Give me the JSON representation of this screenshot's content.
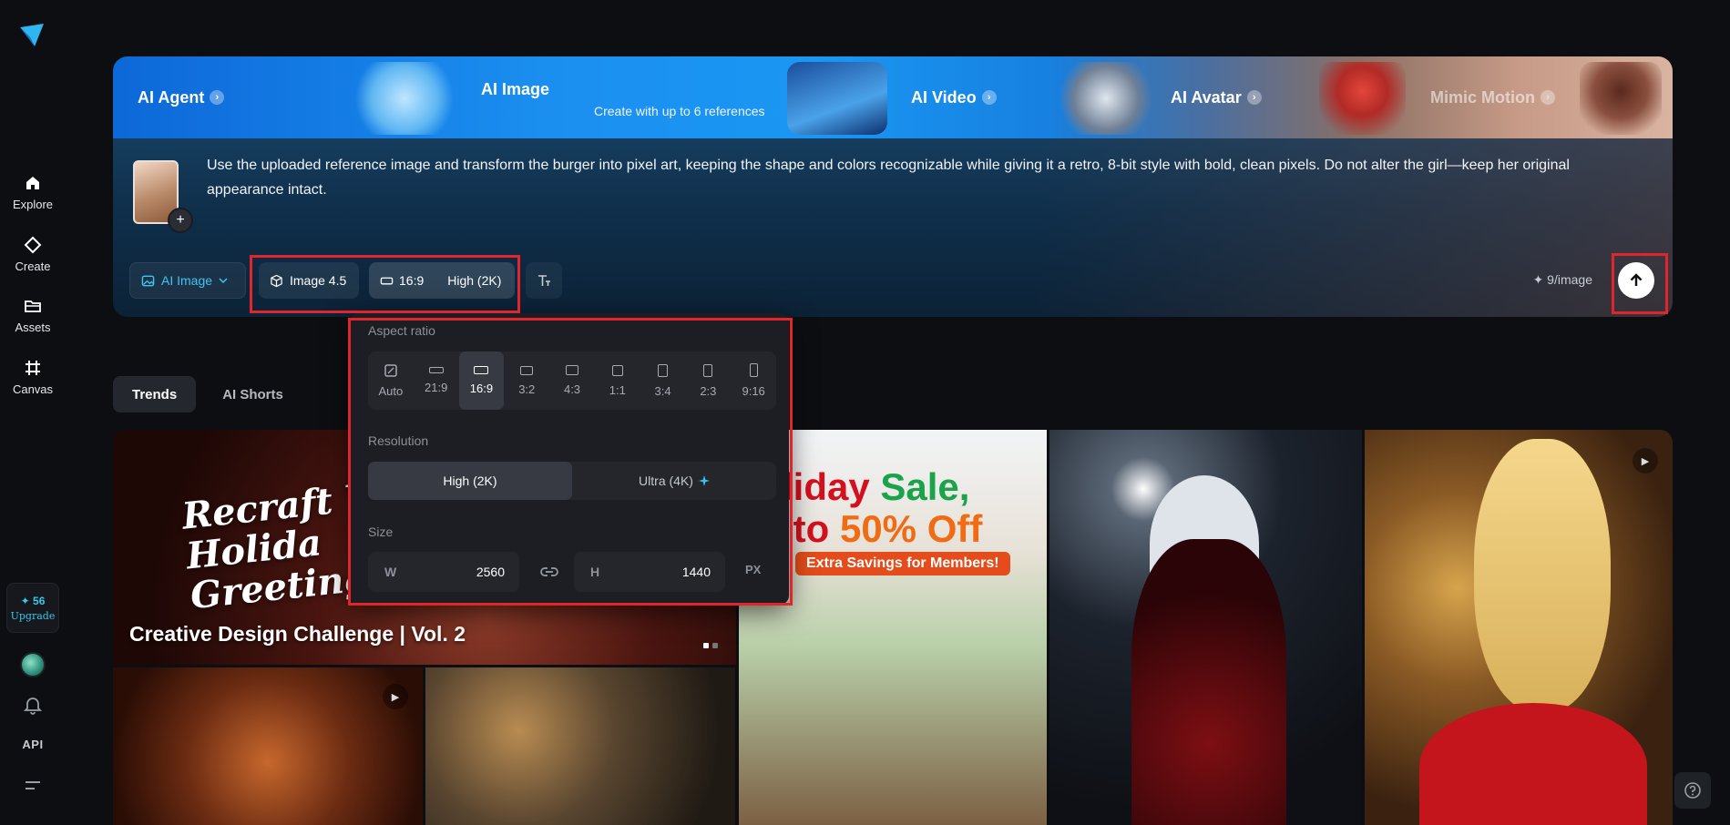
{
  "sidebar": {
    "items": [
      {
        "label": "Explore"
      },
      {
        "label": "Create"
      },
      {
        "label": "Assets"
      },
      {
        "label": "Canvas"
      }
    ],
    "upgrade": {
      "credits": "✦ 56",
      "label": "Upgrade"
    },
    "api_label": "API"
  },
  "banner": {
    "tabs": [
      {
        "label": "AI Agent"
      },
      {
        "label": "AI Image",
        "subtitle": "Create with up to 6 references"
      },
      {
        "label": "AI Video"
      },
      {
        "label": "AI Avatar"
      },
      {
        "label": "Mimic Motion"
      }
    ]
  },
  "prompt": {
    "text": "Use the uploaded reference image and transform the burger into pixel art, keeping the shape and colors recognizable while giving it a retro, 8-bit style with bold, clean pixels. Do not alter the girl—keep her original appearance intact.",
    "add_symbol": "+",
    "mode_label": "AI Image",
    "model_label": "Image 4.5",
    "ratio_label": "16:9",
    "resolution_label": "High (2K)",
    "cost_label": "✦ 9/image"
  },
  "popover": {
    "aspect_label": "Aspect ratio",
    "ratios": [
      "Auto",
      "21:9",
      "16:9",
      "3:2",
      "4:3",
      "1:1",
      "3:4",
      "2:3",
      "9:16"
    ],
    "selected_ratio": "16:9",
    "resolution_label": "Resolution",
    "resolutions": [
      "High (2K)",
      "Ultra (4K)"
    ],
    "size_label": "Size",
    "width_key": "W",
    "width_value": "2560",
    "height_key": "H",
    "height_value": "1440",
    "unit": "PX"
  },
  "tabs": [
    {
      "label": "Trends",
      "active": true
    },
    {
      "label": "AI Shorts",
      "active": false
    }
  ],
  "gallery": {
    "featured_title": "Creative Design Challenge | Vol. 2",
    "featured_script": "Recraft You\nHolida\nGreeting",
    "holiday_line1": "Holiday",
    "holiday_line1b": "Sale,",
    "holiday_line2": "Up to",
    "holiday_line2b": "50% Off",
    "holiday_banner": "Extra Savings for Members!"
  },
  "colors": {
    "accent": "#38c9e8",
    "highlight": "#e0252d",
    "background": "#0d0e11"
  }
}
